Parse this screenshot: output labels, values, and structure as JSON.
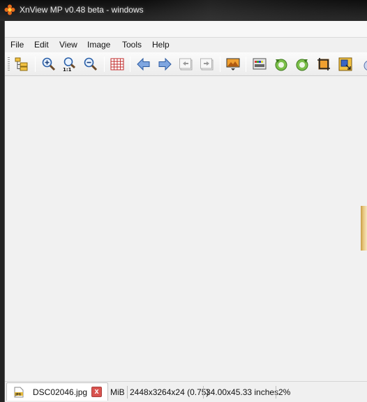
{
  "window": {
    "title": "XnView MP v0.48 beta - windows",
    "icon": "xnview-flower-icon"
  },
  "menu": [
    "File",
    "Edit",
    "View",
    "Image",
    "Tools",
    "Help"
  ],
  "toolbar": {
    "buttons": [
      "browser-icon",
      "zoom-in-icon",
      "zoom-actual-size-icon",
      "zoom-out-icon",
      "grid-icon",
      "previous-icon",
      "next-icon",
      "first-icon",
      "last-icon",
      "slideshow-icon",
      "properties-icon",
      "rotate-left-icon",
      "rotate-right-icon",
      "crop-icon",
      "resize-icon"
    ]
  },
  "tabs": [
    {
      "label": "DSC02046.jpg",
      "icon": "jpg-file-icon",
      "close": "x"
    }
  ],
  "status": {
    "size_unit": "MiB",
    "dimensions": "2448x3264x24 (0.75)",
    "print_size": "34.00x45.33 inches",
    "zoom": "2%"
  },
  "colors": {
    "tab_close": "#d9534f",
    "titlebar": "#1b1b1b",
    "client_bg": "#f0f0f0"
  }
}
